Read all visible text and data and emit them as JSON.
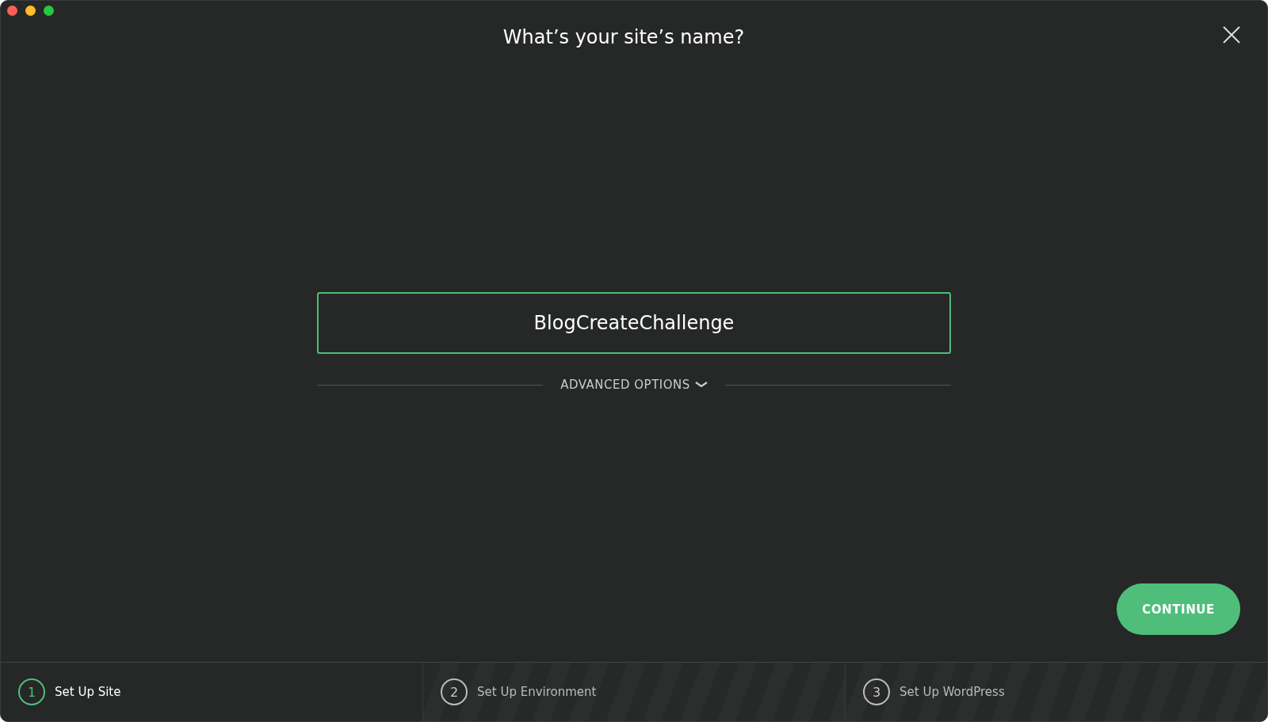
{
  "window": {
    "title": "What’s your site’s name?"
  },
  "site_name": {
    "value": "BlogCreateChallenge"
  },
  "advanced_options": {
    "label": "ADVANCED OPTIONS",
    "expanded": false
  },
  "continue_button": {
    "label": "CONTINUE"
  },
  "steps": [
    {
      "number": "1",
      "label": "Set Up Site",
      "selected": true
    },
    {
      "number": "2",
      "label": "Set Up Environment",
      "selected": false
    },
    {
      "number": "3",
      "label": "Set Up WordPress",
      "selected": false
    }
  ]
}
